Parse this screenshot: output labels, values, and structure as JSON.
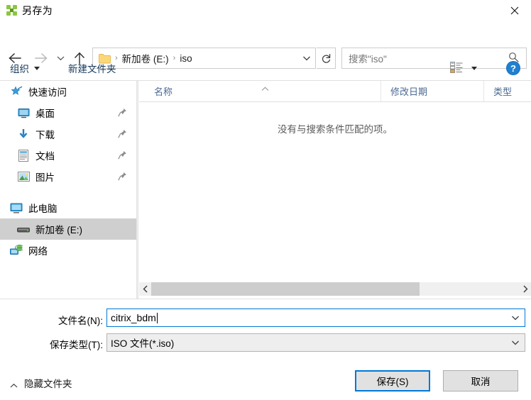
{
  "window": {
    "title": "另存为",
    "icon": "app-puzzle-icon",
    "close_label": "✕"
  },
  "nav": {
    "back_icon": "arrow-left-icon",
    "forward_icon": "arrow-right-icon",
    "recent_icon": "chevron-down-icon",
    "up_icon": "arrow-up-icon",
    "address": {
      "folder_icon": "folder-icon",
      "separator": "›",
      "crumbs": [
        "新加卷 (E:)",
        "iso"
      ],
      "dropdown_icon": "chevron-down-icon"
    },
    "refresh_icon": "refresh-icon",
    "search": {
      "placeholder": "搜索\"iso\"",
      "icon": "search-icon"
    }
  },
  "toolbar": {
    "organize_label": "组织",
    "new_folder_label": "新建文件夹",
    "view_icon": "list-view-icon",
    "view_caret_icon": "chevron-down-icon",
    "help_icon": "help-question-icon",
    "help_glyph": "?"
  },
  "sidebar": {
    "items": [
      {
        "label": "快速访问",
        "icon": "star-pin-icon",
        "group": true,
        "pinned": false,
        "selected": false
      },
      {
        "label": "桌面",
        "icon": "desktop-icon",
        "group": false,
        "pinned": true,
        "selected": false
      },
      {
        "label": "下载",
        "icon": "download-icon",
        "group": false,
        "pinned": true,
        "selected": false
      },
      {
        "label": "文档",
        "icon": "document-icon",
        "group": false,
        "pinned": true,
        "selected": false
      },
      {
        "label": "图片",
        "icon": "picture-icon",
        "group": false,
        "pinned": true,
        "selected": false
      },
      {
        "label": "此电脑",
        "icon": "computer-icon",
        "group": true,
        "pinned": false,
        "selected": false
      },
      {
        "label": "新加卷 (E:)",
        "icon": "drive-icon",
        "group": false,
        "pinned": false,
        "selected": true
      },
      {
        "label": "网络",
        "icon": "network-icon",
        "group": true,
        "pinned": false,
        "selected": false
      }
    ]
  },
  "filelist": {
    "columns": [
      {
        "label": "名称",
        "sorted": true,
        "sort_icon": "sort-ascending-icon"
      },
      {
        "label": "修改日期",
        "sorted": false,
        "sort_icon": ""
      },
      {
        "label": "类型",
        "sorted": false,
        "sort_icon": ""
      }
    ],
    "rows": [],
    "empty_message": "没有与搜索条件匹配的项。",
    "scrollbar": {
      "left_icon": "chevron-left-icon",
      "right_icon": "chevron-right-icon",
      "thumb_percent": 73
    }
  },
  "form": {
    "filename_label": "文件名(N):",
    "filename_value": "citrix_bdm",
    "filename_dropdown_icon": "chevron-down-icon",
    "savetype_label": "保存类型(T):",
    "savetype_value": "ISO 文件(*.iso)",
    "savetype_dropdown_icon": "chevron-down-icon"
  },
  "footer": {
    "hide_folders_label": "隐藏文件夹",
    "hide_folders_icon": "chevron-up-icon",
    "save_label": "保存(S)",
    "cancel_label": "取消"
  },
  "colors": {
    "accent": "#0078d7",
    "header_text": "#4a6a93",
    "toolbar_text": "#16395c",
    "selection": "#cfcfcf"
  }
}
